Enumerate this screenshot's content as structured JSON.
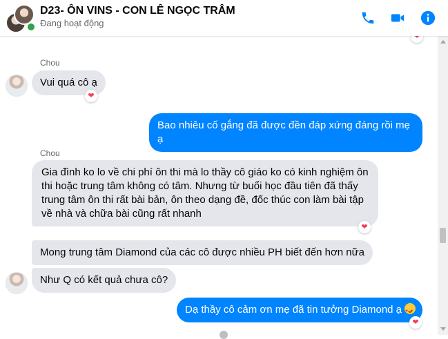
{
  "header": {
    "title": "D23- ÔN VINS - CON LÊ NGỌC TRÂM",
    "status": "Đang hoạt động",
    "icons": [
      "phone-icon",
      "video-camera-icon",
      "info-icon"
    ],
    "accent": "#0084ff"
  },
  "messages": [
    {
      "sender": "Chou",
      "text": "Vui quá cô ạ",
      "direction": "incoming",
      "reaction": "❤"
    },
    {
      "text": "Bao nhiêu cố gắng đã được đền đáp xứng đáng rồi mẹ ạ",
      "direction": "outgoing"
    },
    {
      "sender": "Chou",
      "text": "Gia đình ko lo về chi phí ôn thi mà lo thầy cô giáo ko có kinh nghiệm ôn thi hoặc trung tâm không có tâm. Nhưng từ buổi học đầu tiên đã thấy trung tâm ôn thi rất bài bản, ôn theo dạng đề, đốc thúc con làm bài tập về nhà và chữa bài cũng rất nhanh",
      "direction": "incoming",
      "reaction": "❤"
    },
    {
      "text": "Mong trung tâm Diamond của các cô được nhiều PH biết đến hơn nữa",
      "direction": "incoming"
    },
    {
      "text": "Như Q có kết quả chưa cô?",
      "direction": "incoming"
    },
    {
      "text": "Dạ thầy cô cảm ơn mẹ đã tin tưởng Diamond ạ",
      "direction": "outgoing",
      "emoji": "smiling-face-with-hearts",
      "reaction": "❤"
    }
  ],
  "colors": {
    "incoming_bubble": "#e4e6eb",
    "outgoing_bubble": "#0084ff",
    "heart": "#f33e58"
  }
}
